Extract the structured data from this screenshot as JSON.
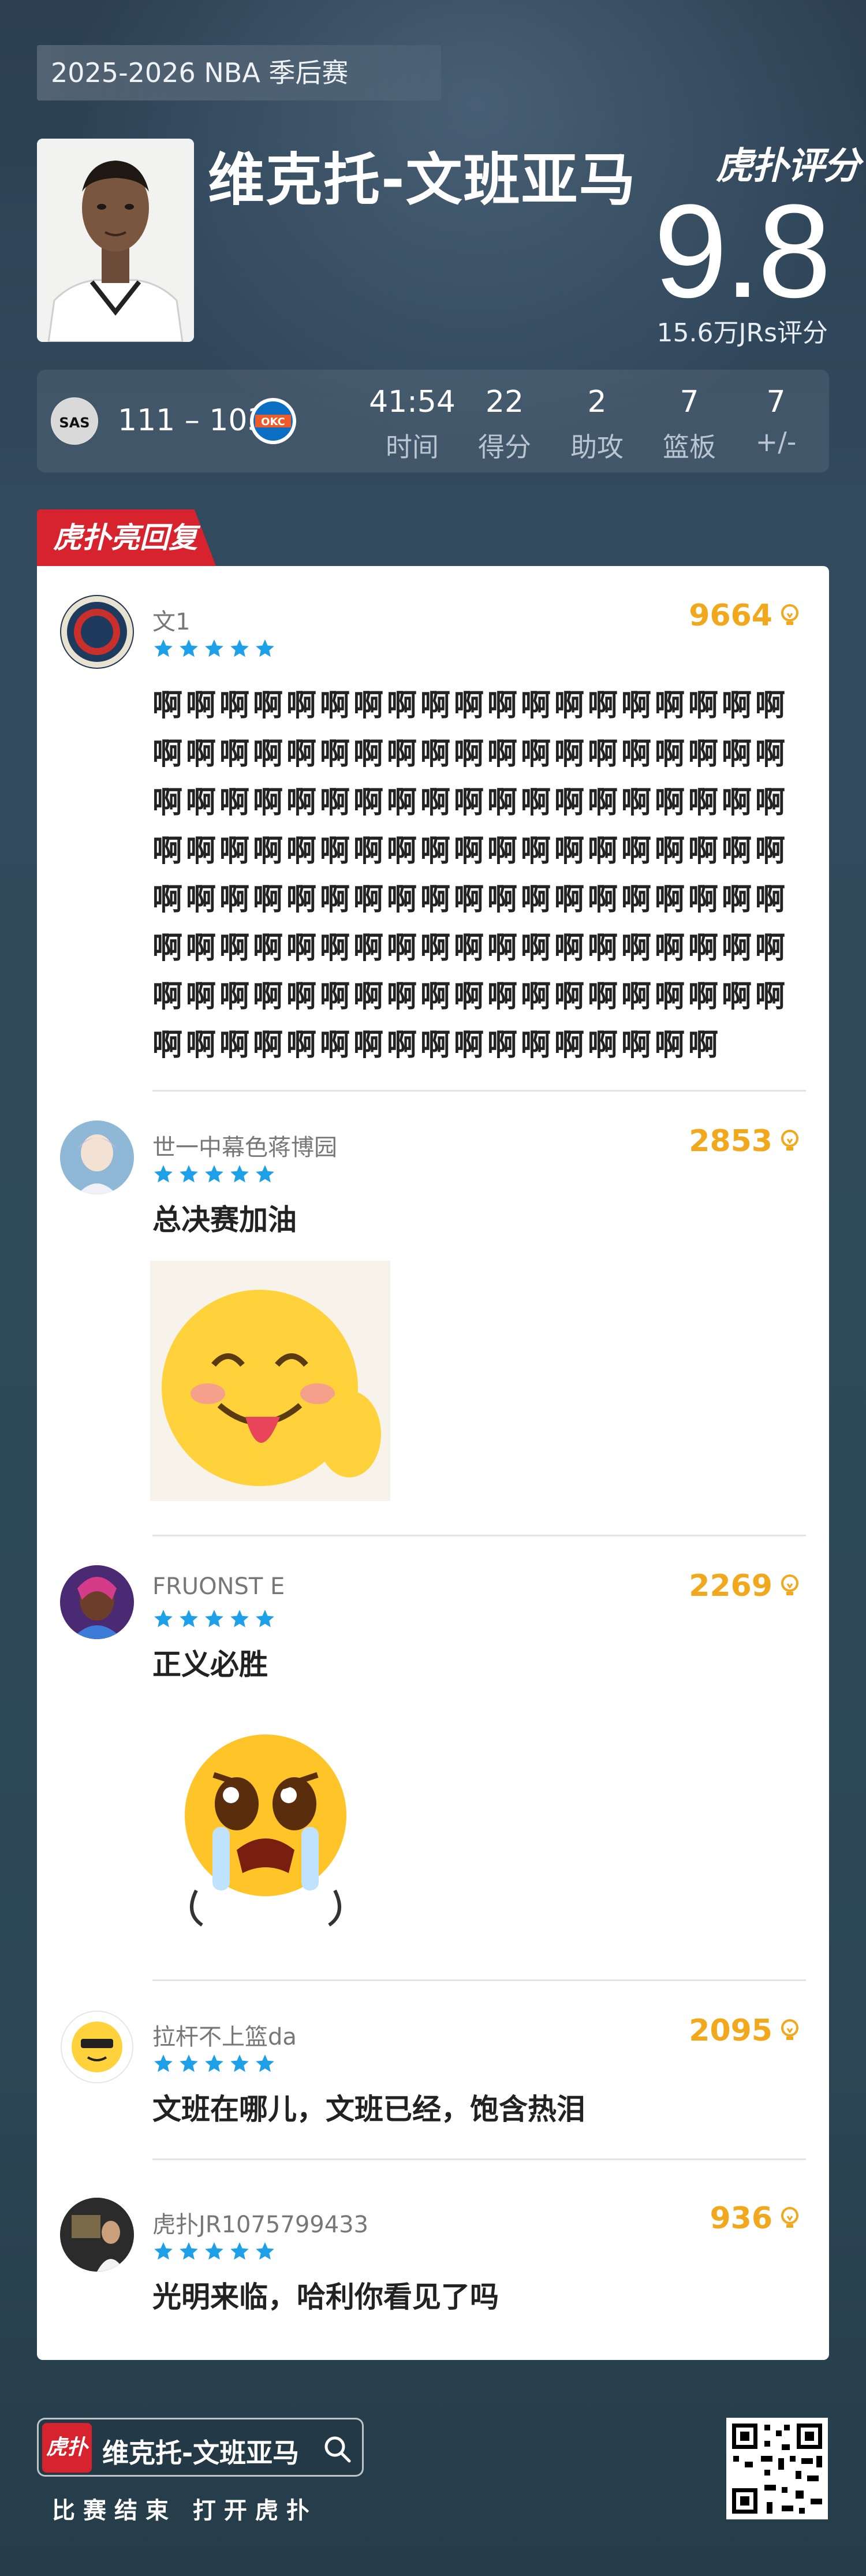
{
  "header": {
    "season": "2025-2026 NBA 季后赛",
    "player_name": "维克托-文班亚马",
    "brand": "虎扑评分",
    "rating": "9.8",
    "rating_count": "15.6万JRs评分"
  },
  "game": {
    "score_home": "111",
    "score_sep": "–",
    "score_away": "103",
    "stats": [
      {
        "value": "41:54",
        "label": "时间"
      },
      {
        "value": "22",
        "label": "得分"
      },
      {
        "value": "2",
        "label": "助攻"
      },
      {
        "value": "7",
        "label": "篮板"
      },
      {
        "value": "7",
        "label": "+/-"
      }
    ]
  },
  "replies_tab": "虎扑亮回复",
  "comments": [
    {
      "username": "文1",
      "stars": 5,
      "likes": "9664",
      "text": "啊啊啊啊啊啊啊啊啊啊啊啊啊啊啊啊啊啊啊啊啊啊啊啊啊啊啊啊啊啊啊啊啊啊啊啊啊啊啊啊啊啊啊啊啊啊啊啊啊啊啊啊啊啊啊啊啊啊啊啊啊啊啊啊啊啊啊啊啊啊啊啊啊啊啊啊啊啊啊啊啊啊啊啊啊啊啊啊啊啊啊啊啊啊啊啊啊啊啊啊啊啊啊啊啊啊啊啊啊啊啊啊啊啊啊啊啊啊啊啊啊啊啊啊啊啊啊啊啊啊啊啊啊啊啊啊啊啊啊啊啊啊啊啊啊啊啊啊啊啊"
    },
    {
      "username": "世一中幕色蒋博园",
      "stars": 5,
      "likes": "2853",
      "text": "总决赛加油"
    },
    {
      "username": "FRUONST E",
      "stars": 5,
      "likes": "2269",
      "text": "正义必胜"
    },
    {
      "username": "拉杆不上篮da",
      "stars": 5,
      "likes": "2095",
      "text": "文班在哪儿，文班已经，饱含热泪"
    },
    {
      "username": "虎扑JR1075799433",
      "stars": 5,
      "likes": "936",
      "text": "光明来临，哈利你看见了吗"
    }
  ],
  "footer": {
    "logo_text": "虎扑",
    "search_name": "维克托-文班亚马",
    "slogan": "比赛结束 打开虎扑"
  }
}
